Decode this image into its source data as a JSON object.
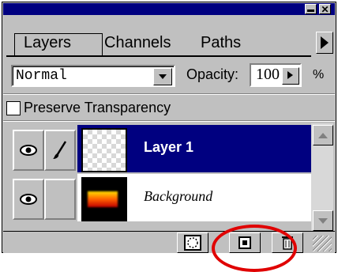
{
  "tabs": [
    {
      "label": "Layers"
    },
    {
      "label": "Channels"
    },
    {
      "label": "Paths"
    }
  ],
  "blend_mode": "Normal",
  "opacity": {
    "label": "Opacity:",
    "value": "100",
    "unit": "%"
  },
  "preserve_transparency": {
    "label": "Preserve Transparency",
    "checked": false
  },
  "layers": [
    {
      "name": "Layer 1",
      "selected": true
    },
    {
      "name": "Background",
      "selected": false
    }
  ],
  "colors": {
    "selection": "#000080",
    "panel": "#c0c0c0",
    "highlight_circle": "#e00000"
  },
  "icons": [
    "minimize-icon",
    "close-icon",
    "panel-menu-arrow-icon",
    "eye-icon",
    "brush-icon",
    "mask-icon",
    "new-layer-icon",
    "trash-icon"
  ]
}
